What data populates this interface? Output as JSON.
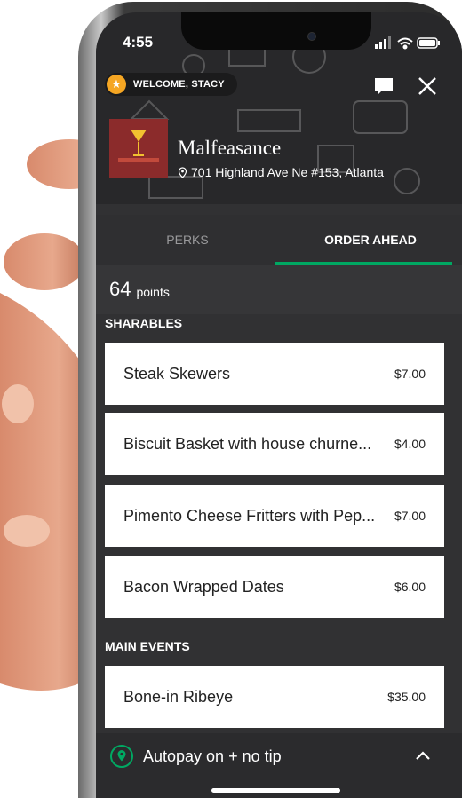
{
  "status": {
    "time": "4:55"
  },
  "header": {
    "welcome": "WELCOME, STACY",
    "venue_name": "Malfeasance",
    "address": "701 Highland Ave Ne #153, Atlanta"
  },
  "tabs": [
    {
      "label": "PERKS",
      "active": false
    },
    {
      "label": "ORDER AHEAD",
      "active": true
    }
  ],
  "points": {
    "value": "64",
    "label": "points"
  },
  "sections": [
    {
      "title": "SHARABLES",
      "items": [
        {
          "name": "Steak Skewers",
          "price": "$7.00"
        },
        {
          "name": "Biscuit Basket with house churne...",
          "price": "$4.00"
        },
        {
          "name": "Pimento Cheese Fritters with Pep...",
          "price": "$7.00"
        },
        {
          "name": "Bacon Wrapped Dates",
          "price": "$6.00"
        }
      ]
    },
    {
      "title": "MAIN EVENTS",
      "items": [
        {
          "name": "Bone-in Ribeye",
          "price": "$35.00"
        }
      ]
    }
  ],
  "footer": {
    "autopay": "Autopay on + no tip"
  },
  "colors": {
    "accent_green": "#00a862",
    "star_badge": "#f5a623",
    "screen_bg": "#313133",
    "logo_bg": "#8b2b2b"
  },
  "icons": [
    "star-icon",
    "chat-icon",
    "close-icon",
    "location-pin-icon",
    "chevron-up-icon",
    "signal-icon",
    "wifi-icon",
    "battery-icon"
  ]
}
